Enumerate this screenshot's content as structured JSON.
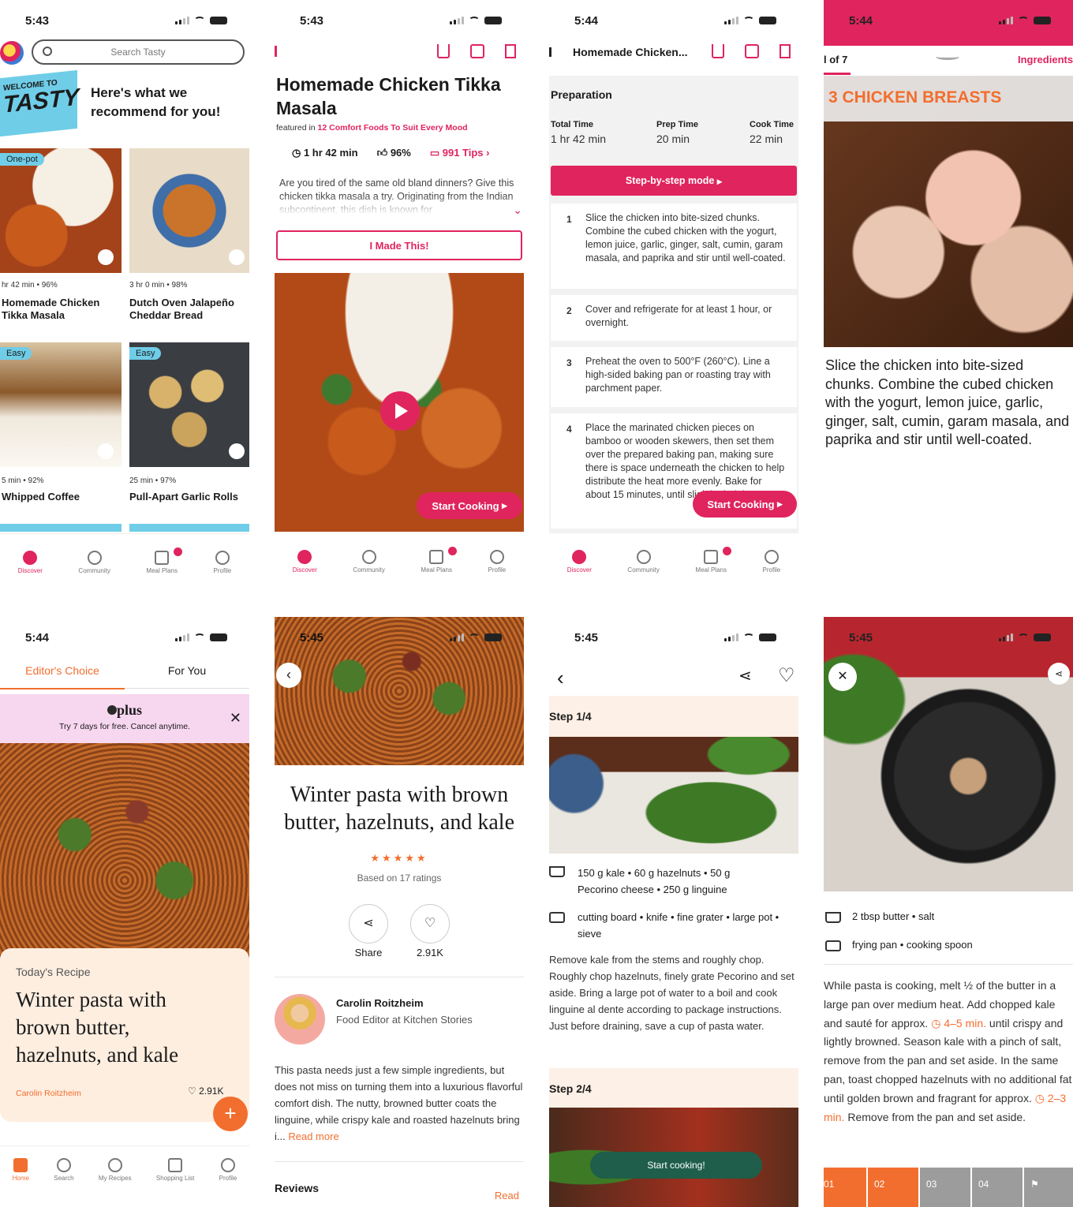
{
  "status": {
    "t1": "5:43",
    "t2": "5:43",
    "t3": "5:44",
    "t4": "5:44",
    "t5": "5:44",
    "t6": "5:45",
    "t7": "5:45",
    "t8": "5:45"
  },
  "tasty": {
    "search_placeholder": "Search Tasty",
    "welcome_small": "WELCOME TO",
    "welcome_logo": "TASTY",
    "recommend": "Here's what we recommend for you!",
    "cards": [
      {
        "badge": "One-pot",
        "meta": "hr 42 min • 96%",
        "title": "Homemade Chicken Tikka Masala"
      },
      {
        "badge": "",
        "meta": "3 hr 0 min • 98%",
        "title": "Dutch Oven Jalapeño Cheddar Bread"
      },
      {
        "badge": "Easy",
        "meta": "5 min • 92%",
        "title": "Whipped Coffee"
      },
      {
        "badge": "Easy",
        "meta": "25 min • 97%",
        "title": "Pull-Apart Garlic Rolls"
      }
    ],
    "nav": [
      "Discover",
      "Community",
      "Meal Plans",
      "Profile"
    ]
  },
  "recipe": {
    "title": "Homemade Chicken Tikka Masala",
    "featured_prefix": "featured in",
    "featured_link": "12 Comfort Foods To Suit Every Mood",
    "time": "1 hr 42 min",
    "rating": "96%",
    "tips": "991 Tips",
    "desc": "Are you tired of the same old bland dinners? Give this chicken tikka masala a try. Originating from the Indian subcontinent, this dish is known for",
    "made_this": "I Made This!",
    "start_cooking": "Start Cooking"
  },
  "prep": {
    "header": "Homemade Chicken...",
    "section": "Preparation",
    "total_label": "Total Time",
    "total": "1 hr 42 min",
    "prep_label": "Prep Time",
    "prep": "20 min",
    "cook_label": "Cook Time",
    "cook": "22 min",
    "step_mode": "Step-by-step mode",
    "steps": [
      {
        "n": "1",
        "text": "Slice the chicken into bite-sized chunks. Combine the cubed chicken with the yogurt, lemon juice, garlic, ginger, salt, cumin, garam masala, and paprika and stir until well-coated."
      },
      {
        "n": "2",
        "text": "Cover and refrigerate for at least 1 hour, or overnight."
      },
      {
        "n": "3",
        "text": "Preheat the oven to 500°F (260°C). Line a high-sided baking pan or roasting tray with parchment paper."
      },
      {
        "n": "4",
        "text": "Place the marinated chicken pieces on bamboo or wooden skewers, then set them over the prepared baking pan, making sure there is space underneath the chicken to help distribute the heat more evenly. Bake for about 15 minutes, until slightly dark brown."
      }
    ],
    "start_cooking": "Start Cooking"
  },
  "stepview": {
    "counter": "l of 7",
    "tab": "Ingredients",
    "overlay": "3 CHICKEN BREASTS",
    "text": "Slice the chicken into bite-sized chunks. Combine the cubed chicken with the yogurt, lemon juice, garlic, ginger, salt, cumin, garam masala, and paprika and stir until well-coated."
  },
  "ks_home": {
    "tab1": "Editor's Choice",
    "tab2": "For You",
    "plus": "plus",
    "plus_sub": "Try 7 days for free. Cancel anytime.",
    "today": "Today's Recipe",
    "title": "Winter pasta with brown butter, hazelnuts, and kale",
    "author": "Carolin Roitzheim",
    "likes": "2.91K",
    "nav": [
      "Home",
      "Search",
      "My Recipes",
      "Shopping List",
      "Profile"
    ]
  },
  "ks_recipe": {
    "title": "Winter pasta with brown butter, hazelnuts, and kale",
    "stars": "★★★★★",
    "ratings": "Based on 17 ratings",
    "share": "Share",
    "likes": "2.91K",
    "author": "Carolin Roitzheim",
    "role": "Food Editor at Kitchen Stories",
    "desc": "This pasta needs just a few simple ingredients, but does not miss on turning them into a luxurious flavorful comfort dish. The nutty, browned butter coats the linguine, while crispy kale and roasted hazelnuts bring i...",
    "read_more": "Read more",
    "reviews": "Reviews",
    "read": "Read"
  },
  "ks_steps": {
    "step1": "Step 1/4",
    "ing": "150 g kale • 60 g hazelnuts • 50 g Pecorino cheese • 250 g linguine",
    "tools": "cutting board • knife • fine grater • large pot • sieve",
    "text": "Remove kale from the stems and roughly chop. Roughly chop hazelnuts, finely grate Pecorino and set aside. Bring a large pot of water to a boil and cook linguine al dente according to package instructions. Just before draining, save a cup of pasta water.",
    "step2": "Step 2/4",
    "start": "Start cooking!"
  },
  "ks_cook": {
    "ing": "2 tbsp butter • salt",
    "tools": "frying pan • cooking spoon",
    "t1": "While pasta is cooking, melt ½ of the butter in a large pan over medium heat. Add chopped kale and sauté for approx.",
    "timer1": "4–5 min.",
    "t2": "until crispy and lightly browned. Season kale with a pinch of salt, remove from the pan and set aside. In the same pan, toast chopped hazelnuts with no additional fat until golden brown and fragrant for approx.",
    "timer2": "2–3 min.",
    "t3": "Remove from the pan and set aside.",
    "steps": [
      "01",
      "02",
      "03",
      "04"
    ]
  },
  "colors": {
    "tasty_pink": "#e0245e",
    "ks_orange": "#f26e2e",
    "ks_green": "#1e5e4a"
  }
}
